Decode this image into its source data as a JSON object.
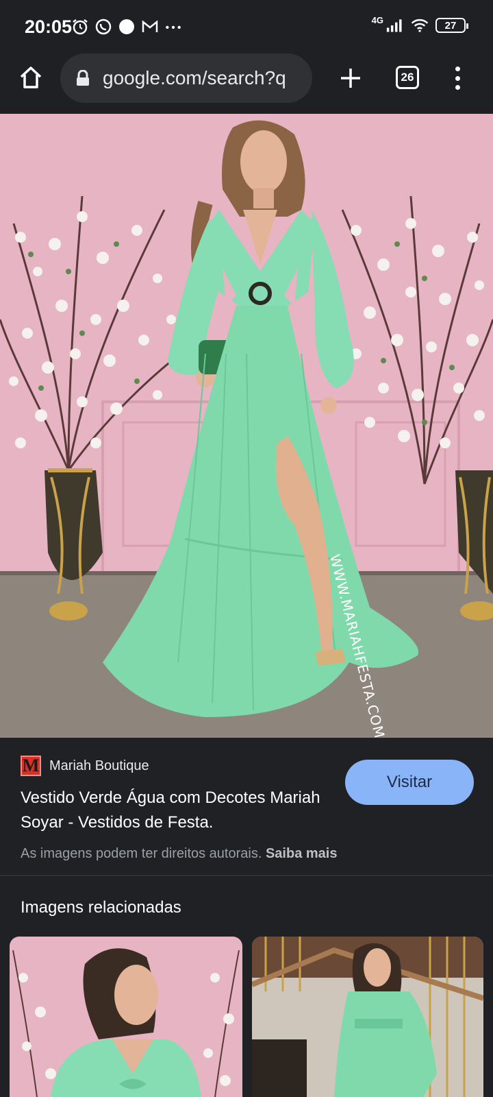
{
  "status_bar": {
    "time": "20:05",
    "network": "4G",
    "battery": "27",
    "icons": [
      "alarm-icon",
      "whatsapp-icon",
      "dot-icon",
      "gmail-icon",
      "more-icon",
      "signal-icon",
      "wifi-icon",
      "battery-icon"
    ]
  },
  "browser": {
    "url": "google.com/search?q",
    "tab_count": "26",
    "icons": [
      "home-icon",
      "lock-icon",
      "plus-icon",
      "tabs-icon",
      "menu-icon"
    ]
  },
  "image": {
    "watermark": "WWW.MARIAHFESTA.COM.BR"
  },
  "result": {
    "favicon_letter": "M",
    "source": "Mariah Boutique",
    "title": "Vestido Verde Água com Decotes Mariah Soyar - Vestidos de Festa.",
    "visit_label": "Visitar",
    "copyright_text": "As imagens podem ter direitos autorais.",
    "learn_more": "Saiba mais"
  },
  "related": {
    "heading": "Imagens relacionadas"
  },
  "colors": {
    "background": "#202124",
    "accent": "#8ab4f8",
    "dress": "#7fdcae",
    "wall": "#e9b6c4"
  }
}
